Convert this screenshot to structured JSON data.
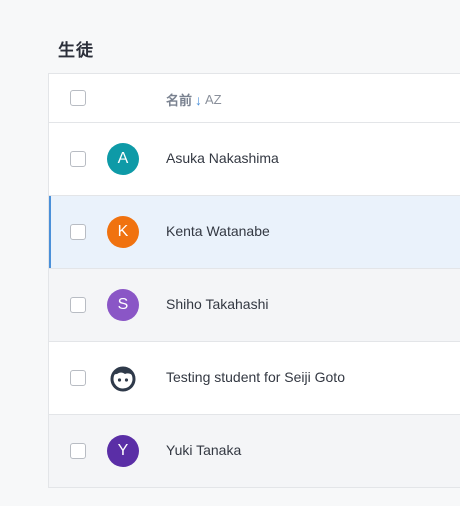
{
  "section": {
    "title": "生徒"
  },
  "table": {
    "name_header": "名前",
    "sort_icon": "arrow-down-icon",
    "sort_az": "AZ",
    "rows": [
      {
        "initial": "A",
        "name": "Asuka Nakashima",
        "color": "#0e9aa7",
        "selected": false
      },
      {
        "initial": "K",
        "name": "Kenta Watanabe",
        "color": "#f0720f",
        "selected": true
      },
      {
        "initial": "S",
        "name": "Shiho Takahashi",
        "color": "#8a56c6",
        "selected": false
      },
      {
        "initial": "",
        "name": "Testing student for Seiji Goto",
        "color": "#2f3a4a",
        "selected": false,
        "icon": "face-avatar-icon"
      },
      {
        "initial": "Y",
        "name": "Yuki Tanaka",
        "color": "#5a2ea6",
        "selected": false
      }
    ]
  }
}
